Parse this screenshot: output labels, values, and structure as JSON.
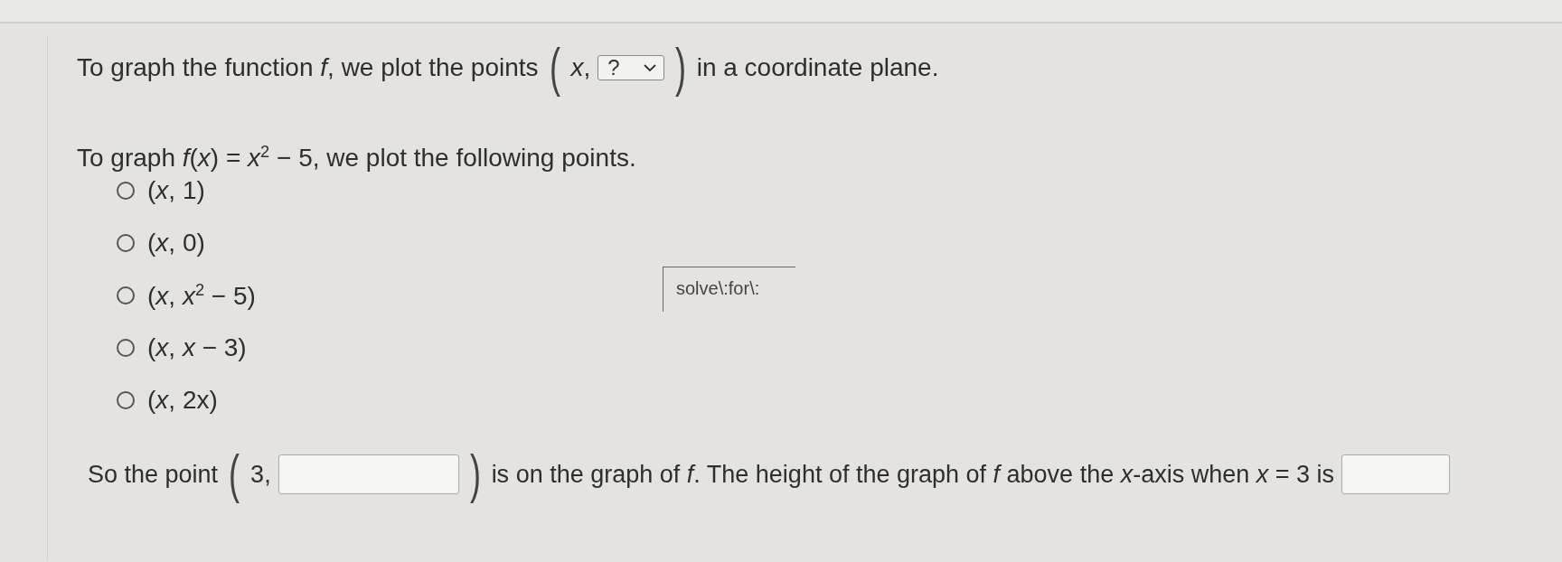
{
  "question_1": {
    "before": "To graph the function *f*, we plot the points",
    "open_paren": "(",
    "x_label": "*x*,",
    "dropdown": {
      "value": "?"
    },
    "close_paren": ")",
    "after": "in a coordinate plane."
  },
  "question_2": {
    "prompt": "To graph *f*(*x*) = *x*$^{2}$ − 5, we plot the following points.",
    "options": [
      {
        "label": "(*x*, 1)",
        "selected": false
      },
      {
        "label": "(*x*, 0)",
        "selected": false
      },
      {
        "label": "(*x*, *x*$^{2}$ − 5)",
        "selected": false
      },
      {
        "label": "(*x*, *x* − 3)",
        "selected": false
      },
      {
        "label": "(*x*, 2x)",
        "selected": false
      }
    ]
  },
  "hint_box": {
    "text": "solve\\:for\\:"
  },
  "question_3": {
    "before": "So the point",
    "open_paren": "(",
    "x_value": "3,",
    "close_paren": ")",
    "middle": "is on the graph of *f*. The height of the graph of *f* above the *x*-axis when *x* = 3 is"
  }
}
